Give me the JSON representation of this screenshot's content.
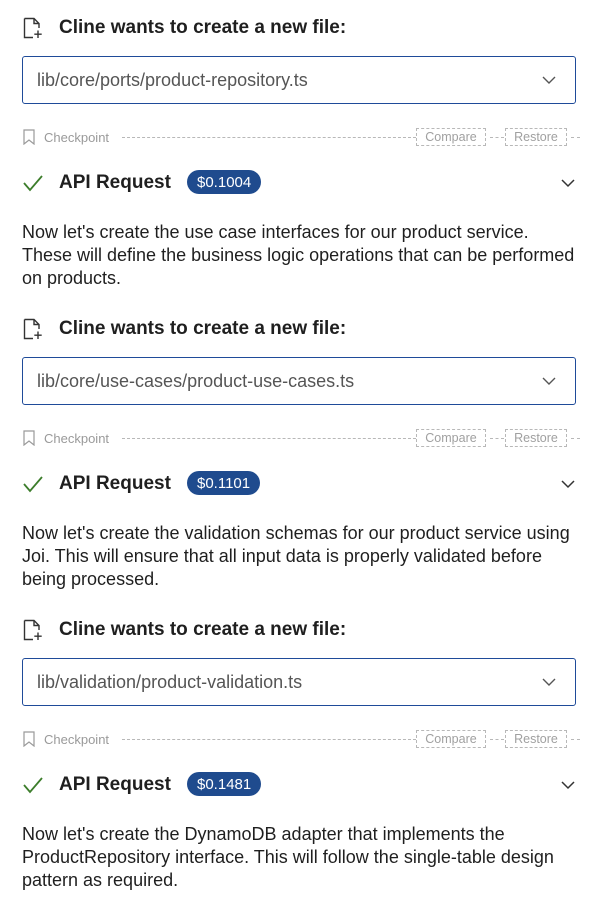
{
  "blocks": [
    {
      "header": "Cline wants to create a new file:",
      "file_path": "lib/core/ports/product-repository.ts",
      "checkpoint": {
        "label": "Checkpoint",
        "compare": "Compare",
        "restore": "Restore"
      },
      "api_request": {
        "label": "API Request",
        "cost": "$0.1004"
      },
      "text": "Now let's create the use case interfaces for our product service. These will define the business logic operations that can be performed on products."
    },
    {
      "header": "Cline wants to create a new file:",
      "file_path": "lib/core/use-cases/product-use-cases.ts",
      "checkpoint": {
        "label": "Checkpoint",
        "compare": "Compare",
        "restore": "Restore"
      },
      "api_request": {
        "label": "API Request",
        "cost": "$0.1101"
      },
      "text": "Now let's create the validation schemas for our product service using Joi. This will ensure that all input data is properly validated before being processed."
    },
    {
      "header": "Cline wants to create a new file:",
      "file_path": "lib/validation/product-validation.ts",
      "checkpoint": {
        "label": "Checkpoint",
        "compare": "Compare",
        "restore": "Restore"
      },
      "api_request": {
        "label": "API Request",
        "cost": "$0.1481"
      },
      "text": "Now let's create the DynamoDB adapter that implements the ProductRepository interface. This will follow the single-table design pattern as required."
    }
  ],
  "colors": {
    "accent": "#1f4b99",
    "badge_bg": "#1f4b8e",
    "success": "#3c7d2b",
    "muted": "#9a9a9a"
  },
  "icons": {
    "header": "new-file-icon",
    "file_expand": "chevron-down-icon",
    "checkpoint": "bookmark-icon",
    "api_status": "checkmark-icon",
    "api_expand": "chevron-down-icon"
  }
}
